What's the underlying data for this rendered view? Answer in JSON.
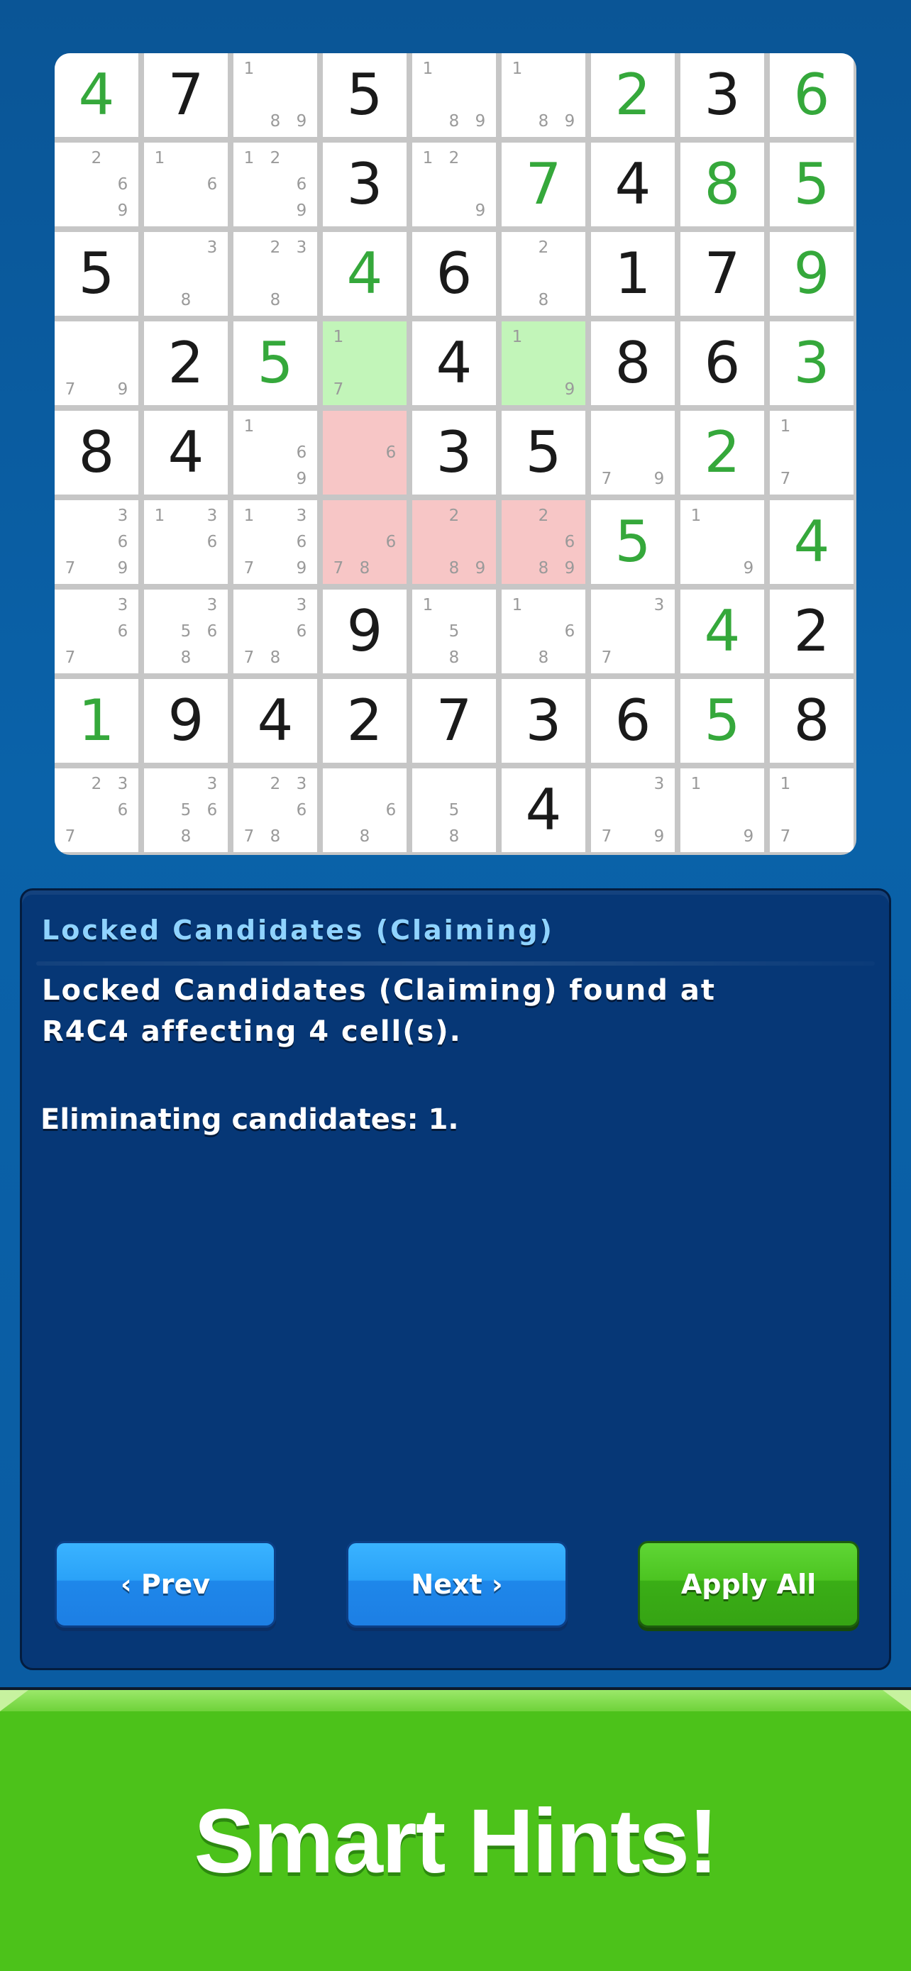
{
  "board": {
    "cells": [
      [
        {
          "v": "4",
          "t": "user"
        },
        {
          "v": "7",
          "t": "given"
        },
        {
          "c": [
            1,
            8,
            9
          ]
        },
        {
          "v": "5",
          "t": "given"
        },
        {
          "c": [
            1,
            8,
            9
          ]
        },
        {
          "c": [
            1,
            8,
            9
          ]
        },
        {
          "v": "2",
          "t": "user"
        },
        {
          "v": "3",
          "t": "given"
        },
        {
          "v": "6",
          "t": "user"
        }
      ],
      [
        {
          "c": [
            2,
            6,
            9
          ]
        },
        {
          "c": [
            1,
            6
          ]
        },
        {
          "c": [
            1,
            2,
            6,
            9
          ]
        },
        {
          "v": "3",
          "t": "given"
        },
        {
          "c": [
            1,
            2,
            9
          ]
        },
        {
          "v": "7",
          "t": "user"
        },
        {
          "v": "4",
          "t": "given"
        },
        {
          "v": "8",
          "t": "user"
        },
        {
          "v": "5",
          "t": "user"
        }
      ],
      [
        {
          "v": "5",
          "t": "given"
        },
        {
          "c": [
            3,
            8
          ]
        },
        {
          "c": [
            2,
            3,
            8
          ]
        },
        {
          "v": "4",
          "t": "user"
        },
        {
          "v": "6",
          "t": "given"
        },
        {
          "c": [
            2,
            8
          ]
        },
        {
          "v": "1",
          "t": "given"
        },
        {
          "v": "7",
          "t": "given"
        },
        {
          "v": "9",
          "t": "user"
        }
      ],
      [
        {
          "c": [
            7,
            9
          ]
        },
        {
          "v": "2",
          "t": "given"
        },
        {
          "v": "5",
          "t": "user"
        },
        {
          "c": [
            1,
            7
          ],
          "hl": "green"
        },
        {
          "v": "4",
          "t": "given"
        },
        {
          "c": [
            1,
            9
          ],
          "hl": "green"
        },
        {
          "v": "8",
          "t": "given"
        },
        {
          "v": "6",
          "t": "given"
        },
        {
          "v": "3",
          "t": "user"
        }
      ],
      [
        {
          "v": "8",
          "t": "given"
        },
        {
          "v": "4",
          "t": "given"
        },
        {
          "c": [
            1,
            6,
            9
          ]
        },
        {
          "c": [
            6
          ],
          "hl": "red"
        },
        {
          "v": "3",
          "t": "given"
        },
        {
          "v": "5",
          "t": "given"
        },
        {
          "c": [
            7,
            9
          ]
        },
        {
          "v": "2",
          "t": "user"
        },
        {
          "c": [
            1,
            7
          ]
        }
      ],
      [
        {
          "c": [
            3,
            6,
            7,
            9
          ]
        },
        {
          "c": [
            1,
            3,
            6
          ]
        },
        {
          "c": [
            1,
            3,
            6,
            7,
            9
          ]
        },
        {
          "c": [
            6,
            7,
            8
          ],
          "hl": "red"
        },
        {
          "c": [
            2,
            8,
            9
          ],
          "hl": "red"
        },
        {
          "c": [
            2,
            6,
            8,
            9
          ],
          "hl": "red"
        },
        {
          "v": "5",
          "t": "user"
        },
        {
          "c": [
            1,
            9
          ]
        },
        {
          "v": "4",
          "t": "user"
        }
      ],
      [
        {
          "c": [
            3,
            6,
            7
          ]
        },
        {
          "c": [
            3,
            5,
            6,
            8
          ]
        },
        {
          "c": [
            3,
            6,
            7,
            8
          ]
        },
        {
          "v": "9",
          "t": "given"
        },
        {
          "c": [
            1,
            5,
            8
          ]
        },
        {
          "c": [
            1,
            6,
            8
          ]
        },
        {
          "c": [
            3,
            7
          ]
        },
        {
          "v": "4",
          "t": "user"
        },
        {
          "v": "2",
          "t": "given"
        }
      ],
      [
        {
          "v": "1",
          "t": "user"
        },
        {
          "v": "9",
          "t": "given"
        },
        {
          "v": "4",
          "t": "given"
        },
        {
          "v": "2",
          "t": "given"
        },
        {
          "v": "7",
          "t": "given"
        },
        {
          "v": "3",
          "t": "given"
        },
        {
          "v": "6",
          "t": "given"
        },
        {
          "v": "5",
          "t": "user"
        },
        {
          "v": "8",
          "t": "given"
        }
      ],
      [
        {
          "c": [
            2,
            3,
            6,
            7
          ]
        },
        {
          "c": [
            3,
            5,
            6,
            8
          ]
        },
        {
          "c": [
            2,
            3,
            6,
            7,
            8
          ]
        },
        {
          "c": [
            6,
            8
          ]
        },
        {
          "c": [
            5,
            8
          ]
        },
        {
          "v": "4",
          "t": "given"
        },
        {
          "c": [
            3,
            7,
            9
          ]
        },
        {
          "c": [
            1,
            9
          ]
        },
        {
          "c": [
            1,
            7
          ]
        }
      ]
    ]
  },
  "hint": {
    "title": "Locked Candidates (Claiming)",
    "message_line1": "Locked Candidates (Claiming) found at",
    "message_line2": "R4C4 affecting 4 cell(s).",
    "elimination": "Eliminating candidates: 1."
  },
  "buttons": {
    "prev_label": "‹ Prev",
    "next_label": "Next ›",
    "apply_label": "Apply All"
  },
  "banner": {
    "text": "Smart Hints!"
  },
  "colors": {
    "given_digit": "#1a1a1a",
    "user_digit": "#35a83b",
    "highlight_green": "#c2f5b9",
    "highlight_red": "#f7c6c6",
    "panel_bg": "#063776",
    "banner_bg": "#4cc21a"
  }
}
